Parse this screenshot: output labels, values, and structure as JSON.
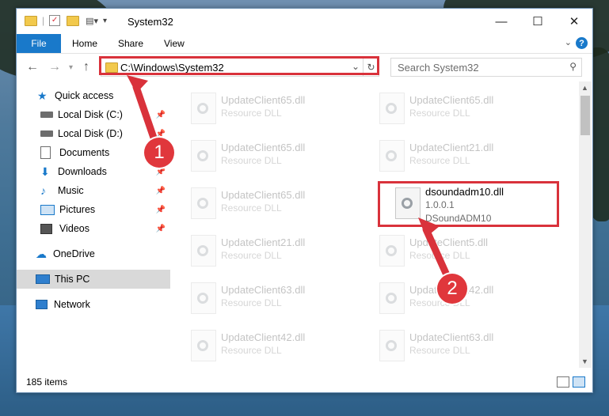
{
  "window": {
    "title": "System32"
  },
  "ribbon": {
    "file": "File",
    "tabs": [
      "Home",
      "Share",
      "View"
    ],
    "help": "?"
  },
  "address": {
    "path": "C:\\Windows\\System32",
    "search_placeholder": "Search System32"
  },
  "sidebar": {
    "items": [
      {
        "label": "Quick access",
        "icon": "star-icon"
      },
      {
        "label": "Local Disk (C:)",
        "icon": "drive-icon"
      },
      {
        "label": "Local Disk (D:)",
        "icon": "drive-icon"
      },
      {
        "label": "Documents",
        "icon": "document-icon"
      },
      {
        "label": "Downloads",
        "icon": "download-icon"
      },
      {
        "label": "Music",
        "icon": "music-icon"
      },
      {
        "label": "Pictures",
        "icon": "pictures-icon"
      },
      {
        "label": "Videos",
        "icon": "video-icon"
      },
      {
        "label": "OneDrive",
        "icon": "cloud-icon"
      },
      {
        "label": "This PC",
        "icon": "computer-icon"
      },
      {
        "label": "Network",
        "icon": "network-icon"
      }
    ]
  },
  "files": [
    {
      "name": "UpdateClient65.dll",
      "desc": "Resource DLL"
    },
    {
      "name": "UpdateClient65.dll",
      "desc": "Resource DLL"
    },
    {
      "name": "UpdateClient65.dll",
      "desc": "Resource DLL"
    },
    {
      "name": "UpdateClient21.dll",
      "desc": "Resource DLL"
    },
    {
      "name": "UpdateClient65.dll",
      "desc": "Resource DLL"
    },
    {
      "name": "dsoundadm10.dll",
      "version": "1.0.0.1",
      "desc": "DSoundADM10"
    },
    {
      "name": "UpdateClient21.dll",
      "desc": "Resource DLL"
    },
    {
      "name": "UpdateClient5.dll",
      "desc": "Resource DLL"
    },
    {
      "name": "UpdateClient63.dll",
      "desc": "Resource DLL"
    },
    {
      "name": "UpdateClient42.dll",
      "desc": "Resource DLL"
    },
    {
      "name": "UpdateClient42.dll",
      "desc": "Resource DLL"
    },
    {
      "name": "UpdateClient63.dll",
      "desc": "Resource DLL"
    }
  ],
  "status": {
    "count": "185 items"
  },
  "callouts": [
    "1",
    "2"
  ],
  "colors": {
    "accent": "#1979ca",
    "highlight": "#d9323b"
  }
}
